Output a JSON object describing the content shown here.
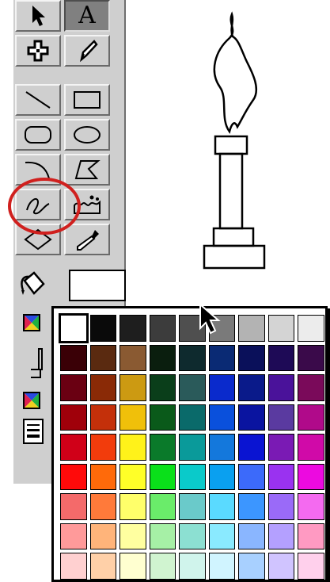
{
  "toolbox": {
    "text_tool_glyph": "A",
    "tools": [
      {
        "row": 0,
        "col": 0,
        "name": "arrow-tool",
        "selected": false,
        "icon": "pointer-arrow-icon"
      },
      {
        "row": 0,
        "col": 1,
        "name": "text-tool",
        "selected": true,
        "icon": "text-a-icon"
      },
      {
        "row": 1,
        "col": 0,
        "name": "hand-tool",
        "selected": false,
        "icon": "hand-cross-icon"
      },
      {
        "row": 1,
        "col": 1,
        "name": "ink-tool",
        "selected": false,
        "icon": "ink-pen-icon"
      },
      {
        "row": 2,
        "col": 0,
        "name": "line-tool",
        "selected": false,
        "icon": "line-icon"
      },
      {
        "row": 2,
        "col": 1,
        "name": "rectangle-tool",
        "selected": false,
        "icon": "rectangle-icon"
      },
      {
        "row": 3,
        "col": 0,
        "name": "rounded-rectangle-tool",
        "selected": false,
        "icon": "rounded-rectangle-icon"
      },
      {
        "row": 3,
        "col": 1,
        "name": "oval-tool",
        "selected": false,
        "icon": "oval-icon"
      },
      {
        "row": 4,
        "col": 0,
        "name": "arc-tool",
        "selected": false,
        "icon": "arc-icon"
      },
      {
        "row": 4,
        "col": 1,
        "name": "polygon-tool",
        "selected": false,
        "icon": "polygon-icon"
      },
      {
        "row": 5,
        "col": 0,
        "name": "freehand-tool",
        "selected": false,
        "icon": "freehand-squiggle-icon",
        "highlighted": true
      },
      {
        "row": 5,
        "col": 1,
        "name": "paint-tool",
        "selected": false,
        "icon": "paint-scribble-icon"
      },
      {
        "row": 6,
        "col": 0,
        "name": "rotate-tool",
        "selected": false,
        "icon": "diamond-icon"
      },
      {
        "row": 6,
        "col": 1,
        "name": "eyedropper-tool",
        "selected": false,
        "icon": "eyedropper-icon"
      }
    ],
    "annotation_color": "#d0201e"
  },
  "colors": {
    "palette_bg": "#cfcfcf",
    "fill_color": "#ffffff"
  },
  "color_popup": {
    "selected_index": 0,
    "swatches": [
      "#ffffff",
      "#0a0a0a",
      "#1e1e1e",
      "#3c3c3c",
      "#4f4f4f",
      "#7a7a7a",
      "#b3b3b3",
      "#d4d4d4",
      "#ececec",
      "#3a0006",
      "#5a2a10",
      "#8a5a32",
      "#0a1e0e",
      "#0e2a2e",
      "#0a2a74",
      "#0a105a",
      "#1e0a56",
      "#3a0a4a",
      "#6a0012",
      "#8a2a06",
      "#cc9a12",
      "#0a3e1a",
      "#2a5a5a",
      "#0a2acc",
      "#0a1a8a",
      "#4a129a",
      "#7a0a5a",
      "#a0000a",
      "#c4300a",
      "#f0c00a",
      "#0a5a1a",
      "#0a6a6a",
      "#0a50dc",
      "#0a14a0",
      "#5a3aa0",
      "#b00a8a",
      "#d00018",
      "#f23c0c",
      "#fff21a",
      "#0a7a2a",
      "#0a9a9a",
      "#1478dc",
      "#0a14d2",
      "#7a1ab4",
      "#d00aa8",
      "#ff0a0a",
      "#ff6a0a",
      "#ffff28",
      "#0ae01a",
      "#0acaca",
      "#0aa0f0",
      "#3c6afa",
      "#9a32f0",
      "#ec0ae0",
      "#f46a6a",
      "#ff7a3a",
      "#ffff6a",
      "#6aec6a",
      "#6acaca",
      "#5adaff",
      "#3c96ff",
      "#9a6af8",
      "#f46af0",
      "#ff9a9a",
      "#ffb47a",
      "#ffffa0",
      "#a6f0a6",
      "#8ce0d2",
      "#8aeaff",
      "#8ab6ff",
      "#b4a0ff",
      "#ff9ac2",
      "#ffd0d0",
      "#ffd0a8",
      "#ffffd0",
      "#d0f4d0",
      "#d0f4ec",
      "#d0f4ff",
      "#a8d0ff",
      "#d0c4ff",
      "#ffd0ec"
    ]
  }
}
